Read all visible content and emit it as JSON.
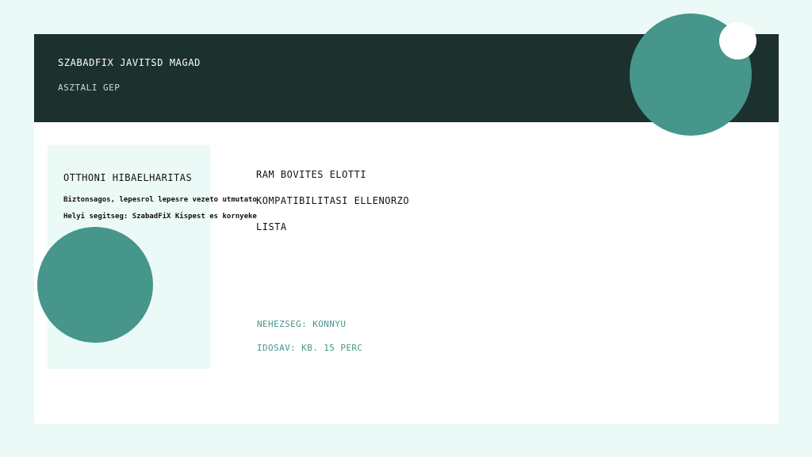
{
  "header": {
    "brand": "SZABADFIX JAVITSD MAGAD",
    "subtitle": "ASZTALI GEP"
  },
  "side_panel": {
    "heading": "OTTHONI HIBAELHARITAS",
    "lines": [
      "Biztonsagos, lepesrol lepesre vezeto utmutato",
      "Helyi segitseg: SzabadFiX Kispest es kornyeke"
    ]
  },
  "main": {
    "title_lines": [
      "RAM BOVITES ELOTTI",
      "KOMPATIBILITASI ELLENORZO",
      "LISTA"
    ],
    "difficulty": "NEHEZSEG: KONNYU",
    "duration": "IDOSAV: KB. 15 PERC"
  },
  "colors": {
    "background": "#ebfaf6",
    "card": "#ffffff",
    "header": "#1c302e",
    "accent": "#46968b",
    "text": "#111111"
  }
}
